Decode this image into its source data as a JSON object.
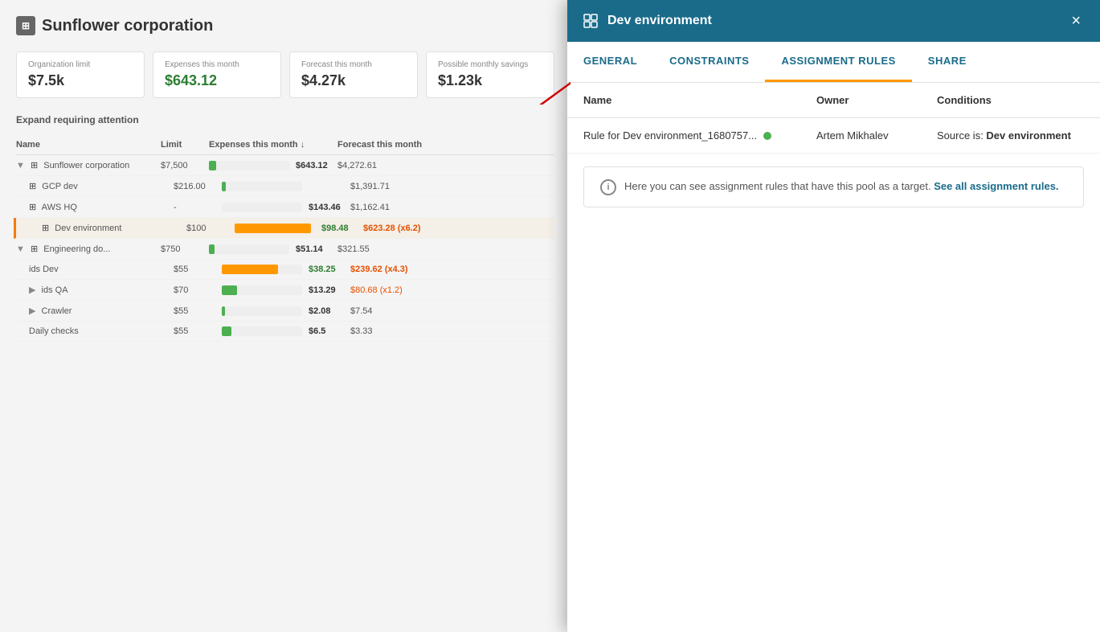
{
  "background": {
    "org_title": "Sunflower corporation",
    "stats": [
      {
        "label": "Organization limit",
        "value": "$7.5k",
        "color": "normal"
      },
      {
        "label": "Expenses this month",
        "value": "$643.12",
        "color": "green"
      },
      {
        "label": "Forecast this month",
        "value": "$4.27k",
        "color": "normal"
      },
      {
        "label": "Possible monthly savings",
        "value": "$1.23k",
        "color": "normal"
      }
    ],
    "expand_label": "Expand requiring attention",
    "table_headers": [
      "Name",
      "Limit",
      "Expenses this month ↓",
      "Forecast this month"
    ],
    "rows": [
      {
        "name": "Sunflower corporation",
        "limit": "$7,500",
        "expense": "$643.12",
        "forecast": "$4,272.61",
        "progress": 9,
        "indent": 0,
        "has_arrow": true
      },
      {
        "name": "GCP dev",
        "limit": "$216.00",
        "expense": "",
        "forecast": "$1,391.71",
        "progress": 5,
        "indent": 1
      },
      {
        "name": "AWS HQ",
        "limit": "-",
        "expense": "$143.46",
        "forecast": "$1,162.41",
        "progress": 0,
        "indent": 1
      },
      {
        "name": "Dev environment",
        "limit": "$100",
        "expense": "$98.48",
        "forecast": "$623.28 (x6.2)",
        "progress": 95,
        "indent": 2,
        "highlighted": true
      },
      {
        "name": "Engineering do...",
        "limit": "$750",
        "expense": "$51.14",
        "forecast": "$321.55",
        "progress": 7,
        "indent": 0
      },
      {
        "name": "ids Dev",
        "limit": "$55",
        "expense": "$38.25",
        "forecast": "$239.62 (x4.3)",
        "progress": 70,
        "indent": 1
      },
      {
        "name": "ids QA",
        "limit": "$70",
        "expense": "$13.29",
        "forecast": "$80.68 (x1.2)",
        "progress": 19,
        "indent": 1
      },
      {
        "name": "Crawler",
        "limit": "$55",
        "expense": "$2.08",
        "forecast": "$7.54",
        "progress": 4,
        "indent": 1
      },
      {
        "name": "Daily checks",
        "limit": "$55",
        "expense": "$6.5",
        "forecast": "$3.33",
        "progress": 12,
        "indent": 1
      }
    ]
  },
  "modal": {
    "title": "Dev environment",
    "close_label": "×",
    "tabs": [
      {
        "id": "general",
        "label": "GENERAL",
        "active": false
      },
      {
        "id": "constraints",
        "label": "CONSTRAINTS",
        "active": false
      },
      {
        "id": "assignment_rules",
        "label": "ASSIGNMENT RULES",
        "active": true
      },
      {
        "id": "share",
        "label": "SHARE",
        "active": false
      }
    ],
    "assignment_rules": {
      "table_headers": {
        "name": "Name",
        "owner": "Owner",
        "conditions": "Conditions"
      },
      "rows": [
        {
          "name": "Rule for Dev environment_1680757...",
          "status": "active",
          "owner": "Artem Mikhalev",
          "conditions": "Source is: Dev environment"
        }
      ],
      "info_text": "Here you can see assignment rules that have this pool as a target.",
      "info_link_text": "See all assignment rules.",
      "info_link_href": "#"
    }
  }
}
